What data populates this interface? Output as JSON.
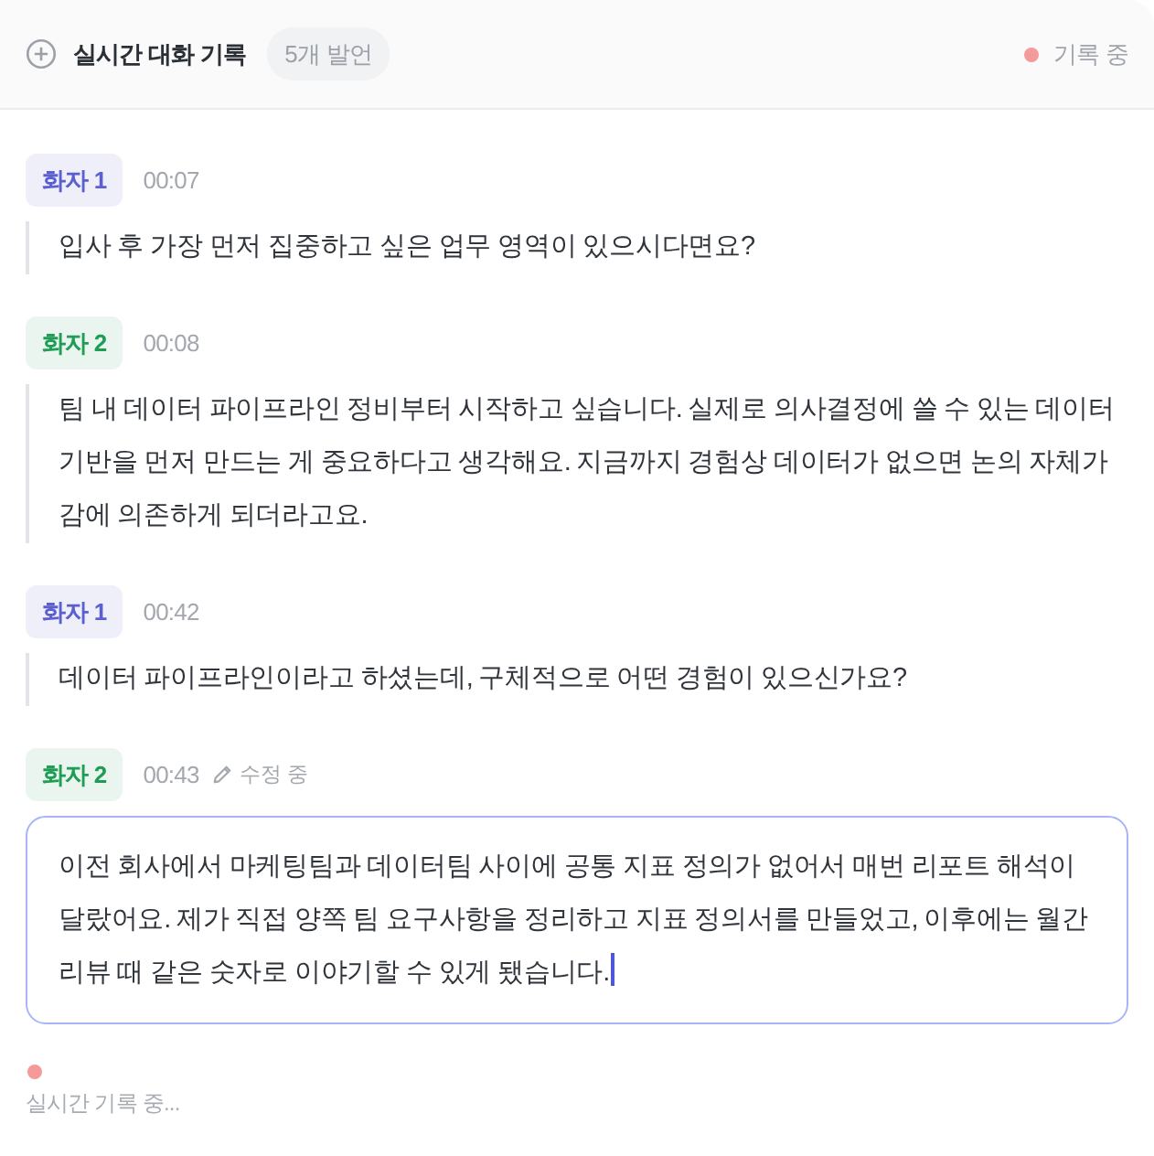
{
  "header": {
    "title": "실시간 대화 기록",
    "count_badge": "5개 발언",
    "status": "기록 중"
  },
  "messages": [
    {
      "kind": "quote",
      "speaker": "화자 1",
      "color": "#5b5fcf",
      "time": "00:07",
      "text": "입사 후 가장 먼저 집중하고 싶은 업무 영역이 있으시다면요?"
    },
    {
      "kind": "quote",
      "speaker": "화자 2",
      "color": "#1f9d55",
      "time": "00:08",
      "text": "팀 내 데이터 파이프라인 정비부터 시작하고 싶습니다. 실제로 의사결정에 쓸 수 있는 데이터 기반을 먼저 만드는 게 중요하다고 생각해요. 지금까지 경험상 데이터가 없으면 논의 자체가 감에 의존하게 되더라고요."
    },
    {
      "kind": "quote",
      "speaker": "화자 1",
      "color": "#5b5fcf",
      "time": "00:42",
      "text": "데이터 파이프라인이라고 하셨는데, 구체적으로 어떤 경험이 있으신가요?"
    },
    {
      "kind": "editing",
      "speaker": "화자 2",
      "color": "#1f9d55",
      "time": "00:43",
      "status_label": "수정 중",
      "text": "이전 회사에서 마케팅팀과 데이터팀 사이에 공통 지표 정의가 없어서 매번 리포트 해석이 달랐어요. 제가 직접 양쪽 팀 요구사항을 정리하고 지표 정의서를 만들었고, 이후에는 월간 리뷰 때 같은 숫자로 이야기할 수 있게 됐습니다."
    }
  ],
  "footer": {
    "status": "실시간 기록 중..."
  }
}
